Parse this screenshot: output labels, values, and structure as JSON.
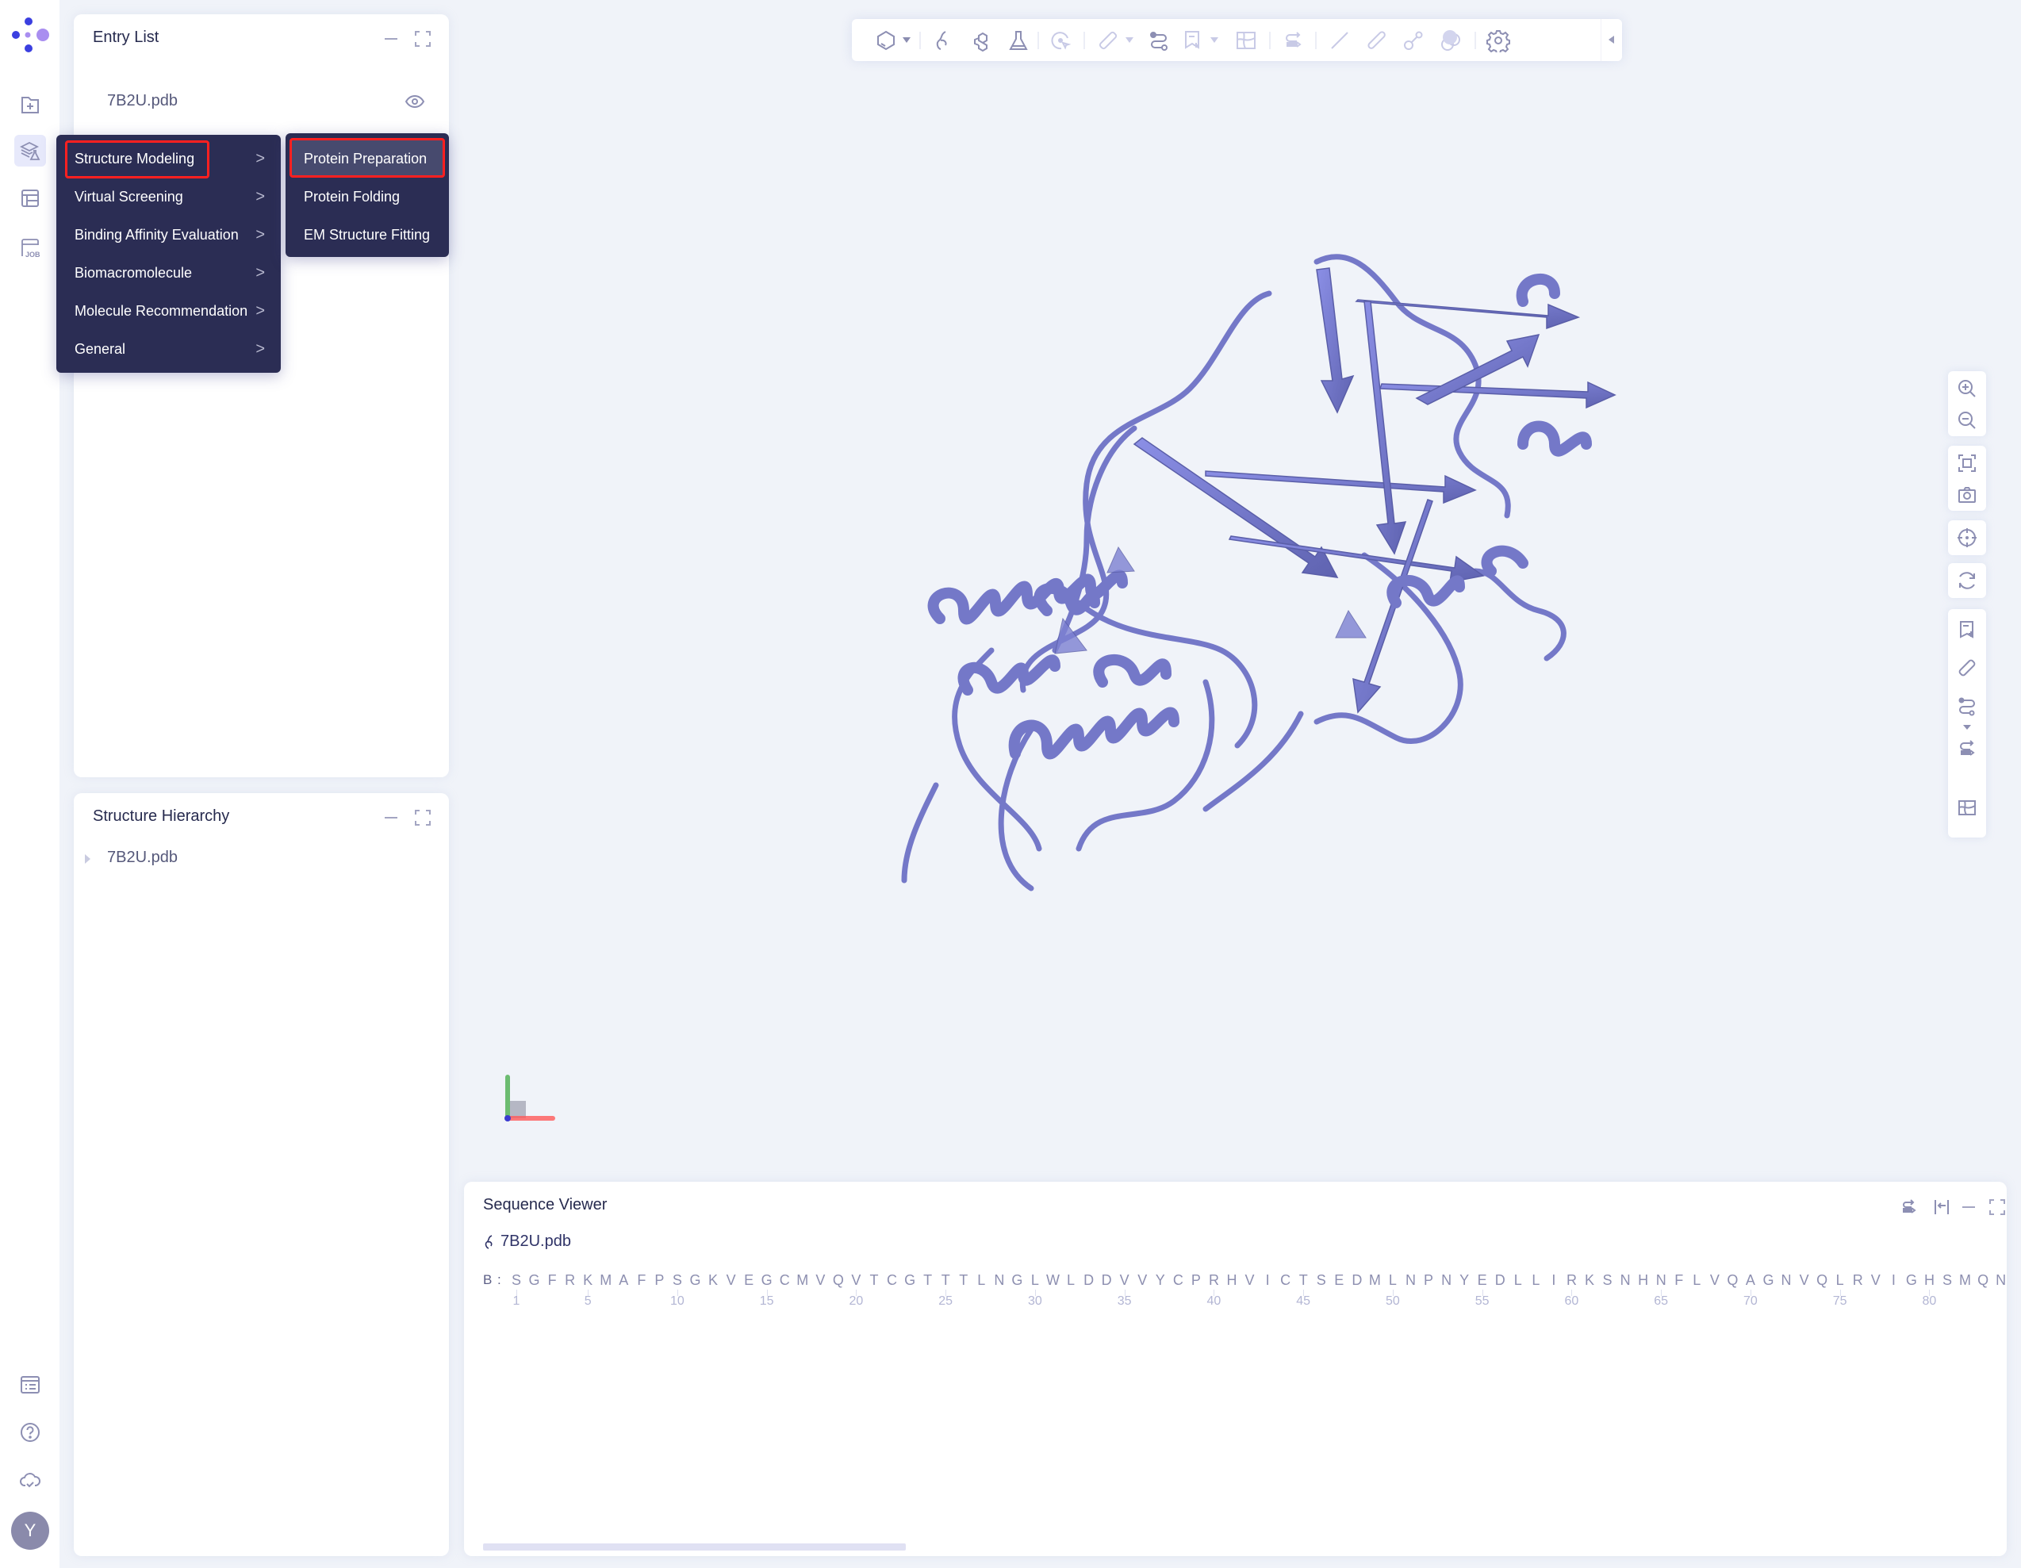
{
  "app": {
    "logo": "app-logo",
    "avatar_initial": "Y"
  },
  "rail": {
    "top_icons": [
      "folder-plus-icon",
      "modeling-flask-icon",
      "layout-icon",
      "job-icon"
    ],
    "active_index": 1,
    "bottom_icons": [
      "task-list-icon",
      "help-icon",
      "cloud-check-icon"
    ]
  },
  "entry_list": {
    "title": "Entry List",
    "items": [
      {
        "name": "7B2U.pdb",
        "visible": true
      }
    ]
  },
  "structure_hierarchy": {
    "title": "Structure Hierarchy",
    "items": [
      {
        "name": "7B2U.pdb",
        "expanded": false
      }
    ]
  },
  "menu": {
    "items": [
      {
        "label": "Structure Modeling",
        "highlighted": true
      },
      {
        "label": "Virtual Screening"
      },
      {
        "label": "Binding Affinity Evaluation"
      },
      {
        "label": "Biomacromolecule"
      },
      {
        "label": "Molecule Recommendation"
      },
      {
        "label": "General"
      }
    ],
    "chevron": ">",
    "submenu": [
      {
        "label": "Protein Preparation",
        "selected": true
      },
      {
        "label": "Protein Folding"
      },
      {
        "label": "EM Structure Fitting"
      }
    ]
  },
  "toolbar": {
    "icons": [
      "molecule-style-icon",
      "protein-icon",
      "ligand-icon",
      "flask-icon",
      "select-target-icon",
      "ruler-icon",
      "path-icon",
      "bookmark-add-icon",
      "surface-map-icon",
      "align-icon",
      "line-icon",
      "stick-icon",
      "ball-stick-icon",
      "spacefill-icon",
      "settings-icon"
    ]
  },
  "right_toolbar": {
    "icons": [
      "zoom-in-icon",
      "zoom-out-icon",
      "fit-screen-icon",
      "camera-icon",
      "center-icon",
      "rotate-icon",
      "bookmark-add-icon",
      "ruler-icon",
      "path-icon",
      "align-icon",
      "surface-map-icon"
    ]
  },
  "sequence_viewer": {
    "title": "Sequence Viewer",
    "file": "7B2U.pdb",
    "chain": "B :",
    "sequence": "SGFRKMAFPSGKVEGCMVQVTCGTTTLNGLWLDDVVYCPRHVICTSEDMLNPNYEDLLIRKSNHNFLVQAGNVQLRVIGHSMQN",
    "tick_every": 5,
    "first_index": 1,
    "header_icons": [
      "align-icon",
      "wrap-icon",
      "minimize-icon",
      "maximize-icon"
    ]
  },
  "colors": {
    "protein": "#7478c8",
    "menu_bg": "#2b2d54",
    "menu_selected": "#474a6e",
    "highlight_border": "#ff2020",
    "axis_x": "#ff5a5a",
    "axis_y": "#4caf50",
    "axis_z": "#3a3ad0"
  }
}
